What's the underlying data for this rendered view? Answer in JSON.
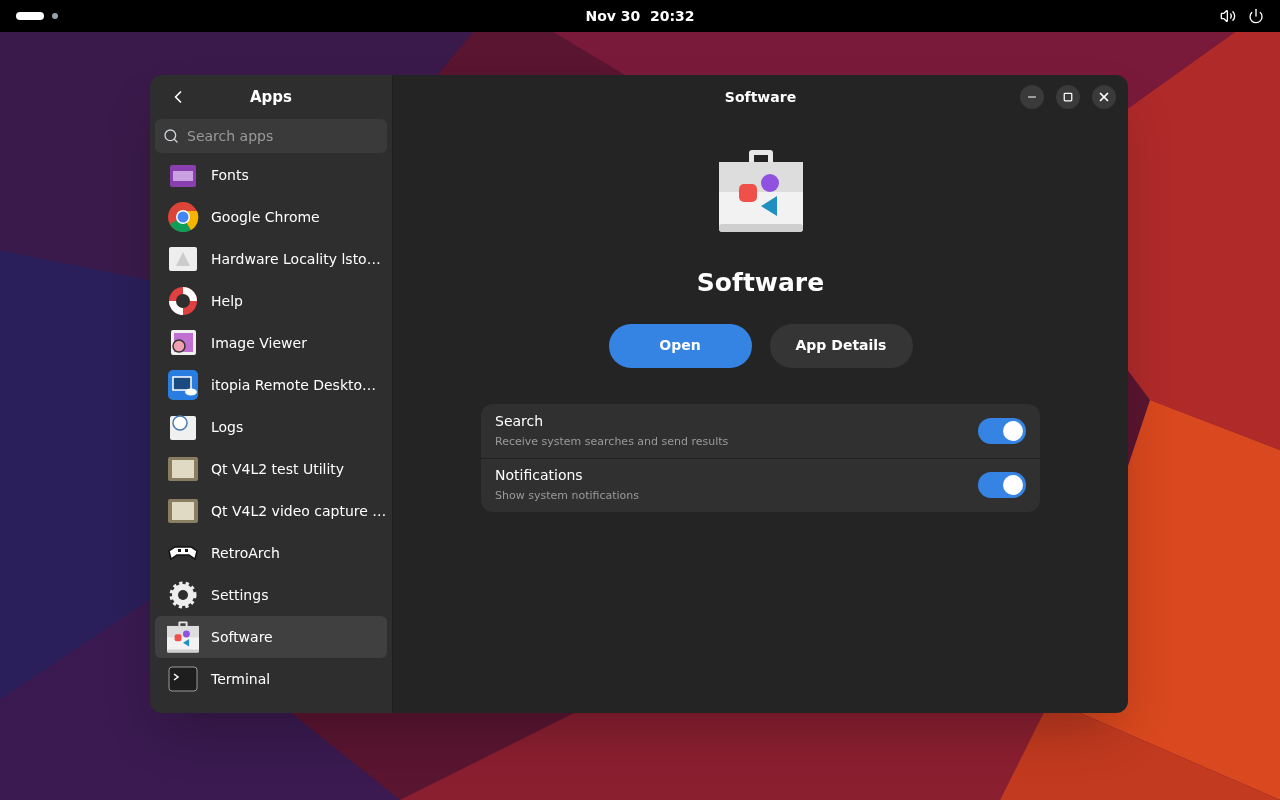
{
  "top_bar": {
    "clock": "Nov 30  20:32"
  },
  "sidebar": {
    "title": "Apps",
    "search": {
      "placeholder": "Search apps"
    },
    "items": [
      {
        "name": "Fonts",
        "selected": false
      },
      {
        "name": "Google Chrome",
        "selected": false
      },
      {
        "name": "Hardware Locality lsto…",
        "selected": false
      },
      {
        "name": "Help",
        "selected": false
      },
      {
        "name": "Image Viewer",
        "selected": false
      },
      {
        "name": "itopia Remote Deskto…",
        "selected": false
      },
      {
        "name": "Logs",
        "selected": false
      },
      {
        "name": "Qt V4L2 test Utility",
        "selected": false
      },
      {
        "name": "Qt V4L2 video capture …",
        "selected": false
      },
      {
        "name": "RetroArch",
        "selected": false
      },
      {
        "name": "Settings",
        "selected": false
      },
      {
        "name": "Software",
        "selected": true
      },
      {
        "name": "Terminal",
        "selected": false
      }
    ]
  },
  "main": {
    "title": "Software",
    "app_name": "Software",
    "buttons": [
      {
        "label": "Open",
        "kind": "primary"
      },
      {
        "label": "App Details",
        "kind": "secondary"
      }
    ],
    "settings": [
      {
        "title": "Search",
        "subtitle": "Receive system searches and send results",
        "on": true
      },
      {
        "title": "Notifications",
        "subtitle": "Show system notifications",
        "on": true
      }
    ]
  }
}
